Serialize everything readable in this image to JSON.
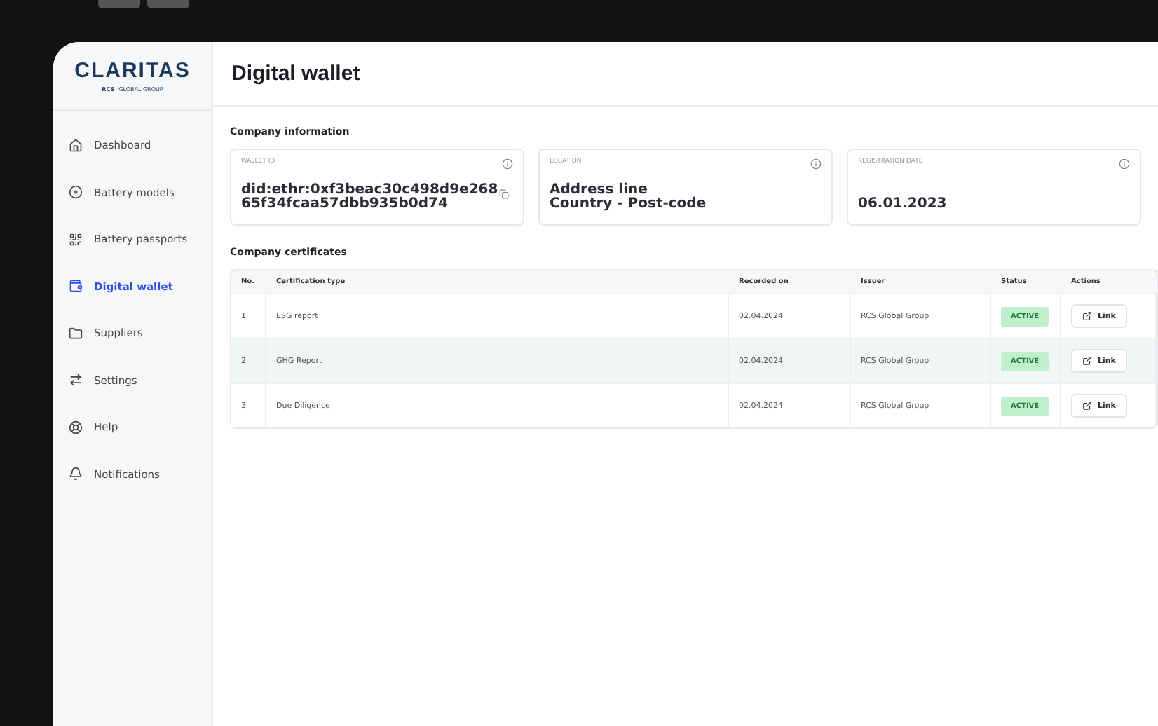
{
  "logo": {
    "name": "CLARITAS",
    "group": "RCS",
    "subtitle": "GLOBAL GROUP"
  },
  "sidebar": {
    "items": [
      {
        "label": "Dashboard",
        "selected": false
      },
      {
        "label": "Battery models",
        "selected": false
      },
      {
        "label": "Battery passports",
        "selected": false
      },
      {
        "label": "Digital wallet",
        "selected": true
      },
      {
        "label": "Suppliers",
        "selected": false
      },
      {
        "label": "Settings",
        "selected": false
      },
      {
        "label": "Help",
        "selected": false
      },
      {
        "label": "Notifications",
        "selected": false
      }
    ]
  },
  "page": {
    "title": "Digital wallet"
  },
  "company_information": {
    "heading": "Company information",
    "cards": [
      {
        "label": "WALLET ID",
        "value": "did:ethr:0xf3beac30c498d9e268\n65f34fcaa57dbb935b0d74",
        "copyable": true
      },
      {
        "label": "LOCATION",
        "value": "Address line\nCountry - Post-code",
        "copyable": false
      },
      {
        "label": "REGISTRATION DATE",
        "value": "06.01.2023",
        "copyable": false
      }
    ]
  },
  "certificates": {
    "heading": "Company certificates",
    "columns": [
      "No.",
      "Certification type",
      "Recorded on",
      "Issuer",
      "Status",
      "Actions"
    ],
    "rows": [
      {
        "no": "1",
        "type": "ESG report",
        "recorded": "02.04.2024",
        "issuer": "RCS Global Group",
        "status": "ACTIVE",
        "action": "Link",
        "selected": false
      },
      {
        "no": "2",
        "type": "GHG Report",
        "recorded": "02.04.2024",
        "issuer": "RCS Global Group",
        "status": "ACTIVE",
        "action": "Link",
        "selected": true
      },
      {
        "no": "3",
        "type": "Due Diligence",
        "recorded": "02.04.2024",
        "issuer": "RCS Global Group",
        "status": "ACTIVE",
        "action": "Link",
        "selected": false
      }
    ]
  }
}
